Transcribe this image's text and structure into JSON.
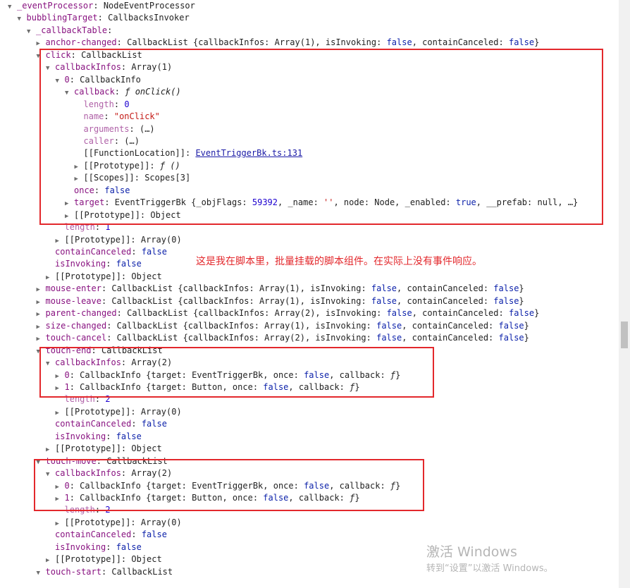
{
  "rows": [
    {
      "indent": 1,
      "arrow": "down",
      "parts": [
        [
          "key-own",
          "_eventProcessor"
        ],
        [
          "type",
          ": NodeEventProcessor"
        ]
      ]
    },
    {
      "indent": 2,
      "arrow": "down",
      "parts": [
        [
          "key-own",
          "bubblingTarget"
        ],
        [
          "type",
          ": CallbacksInvoker"
        ]
      ]
    },
    {
      "indent": 3,
      "arrow": "down",
      "parts": [
        [
          "key-own",
          "_callbackTable"
        ],
        [
          "type",
          ":"
        ]
      ]
    },
    {
      "indent": 4,
      "arrow": "right",
      "parts": [
        [
          "key-own",
          "anchor-changed"
        ],
        [
          "type",
          ": CallbackList {callbackInfos: Array(1), isInvoking: "
        ],
        [
          "bool",
          "false"
        ],
        [
          "type",
          ", containCanceled: "
        ],
        [
          "bool",
          "false"
        ],
        [
          "type",
          "}"
        ]
      ]
    },
    {
      "indent": 4,
      "arrow": "down",
      "parts": [
        [
          "key-own",
          "click"
        ],
        [
          "type",
          ": CallbackList"
        ]
      ]
    },
    {
      "indent": 5,
      "arrow": "down",
      "parts": [
        [
          "key-own",
          "callbackInfos"
        ],
        [
          "type",
          ": Array(1)"
        ]
      ]
    },
    {
      "indent": 6,
      "arrow": "down",
      "parts": [
        [
          "key-own",
          "0"
        ],
        [
          "type",
          ": CallbackInfo"
        ]
      ]
    },
    {
      "indent": 7,
      "arrow": "down",
      "parts": [
        [
          "key-own",
          "callback"
        ],
        [
          "type",
          ": "
        ],
        [
          "fn",
          "ƒ onClick()"
        ]
      ]
    },
    {
      "indent": 8,
      "arrow": "",
      "parts": [
        [
          "key-dim",
          "length"
        ],
        [
          "type",
          ": "
        ],
        [
          "num",
          "0"
        ]
      ]
    },
    {
      "indent": 8,
      "arrow": "",
      "parts": [
        [
          "key-dim",
          "name"
        ],
        [
          "type",
          ": "
        ],
        [
          "str",
          "\"onClick\""
        ]
      ]
    },
    {
      "indent": 8,
      "arrow": "",
      "parts": [
        [
          "key-dim",
          "arguments"
        ],
        [
          "type",
          ": (…)"
        ]
      ]
    },
    {
      "indent": 8,
      "arrow": "",
      "parts": [
        [
          "key-dim",
          "caller"
        ],
        [
          "type",
          ": (…)"
        ]
      ]
    },
    {
      "indent": 8,
      "arrow": "",
      "parts": [
        [
          "type",
          "[[FunctionLocation]]: "
        ],
        [
          "link",
          "EventTriggerBk.ts:131"
        ]
      ]
    },
    {
      "indent": 8,
      "arrow": "right",
      "parts": [
        [
          "type",
          "[[Prototype]]: "
        ],
        [
          "fn",
          "ƒ ()"
        ]
      ]
    },
    {
      "indent": 8,
      "arrow": "right",
      "parts": [
        [
          "type",
          "[[Scopes]]: Scopes[3]"
        ]
      ]
    },
    {
      "indent": 7,
      "arrow": "",
      "parts": [
        [
          "key-own",
          "once"
        ],
        [
          "type",
          ": "
        ],
        [
          "bool",
          "false"
        ]
      ]
    },
    {
      "indent": 7,
      "arrow": "right",
      "parts": [
        [
          "key-own",
          "target"
        ],
        [
          "type",
          ": EventTriggerBk {_objFlags: "
        ],
        [
          "num",
          "59392"
        ],
        [
          "type",
          ", _name: "
        ],
        [
          "str",
          "''"
        ],
        [
          "type",
          ", node: Node, _enabled: "
        ],
        [
          "bool",
          "true"
        ],
        [
          "type",
          ", __prefab: null, …}"
        ]
      ]
    },
    {
      "indent": 7,
      "arrow": "right",
      "parts": [
        [
          "type",
          "[[Prototype]]: Object"
        ]
      ]
    },
    {
      "indent": 6,
      "arrow": "",
      "parts": [
        [
          "key-dim",
          "length"
        ],
        [
          "type",
          ": "
        ],
        [
          "num",
          "1"
        ]
      ]
    },
    {
      "indent": 6,
      "arrow": "right",
      "parts": [
        [
          "type",
          "[[Prototype]]: Array(0)"
        ]
      ]
    },
    {
      "indent": 5,
      "arrow": "",
      "parts": [
        [
          "key-own",
          "containCanceled"
        ],
        [
          "type",
          ": "
        ],
        [
          "bool",
          "false"
        ]
      ]
    },
    {
      "indent": 5,
      "arrow": "",
      "parts": [
        [
          "key-own",
          "isInvoking"
        ],
        [
          "type",
          ": "
        ],
        [
          "bool",
          "false"
        ]
      ]
    },
    {
      "indent": 5,
      "arrow": "right",
      "parts": [
        [
          "type",
          "[[Prototype]]: Object"
        ]
      ]
    },
    {
      "indent": 4,
      "arrow": "right",
      "parts": [
        [
          "key-own",
          "mouse-enter"
        ],
        [
          "type",
          ": CallbackList {callbackInfos: Array(1), isInvoking: "
        ],
        [
          "bool",
          "false"
        ],
        [
          "type",
          ", containCanceled: "
        ],
        [
          "bool",
          "false"
        ],
        [
          "type",
          "}"
        ]
      ]
    },
    {
      "indent": 4,
      "arrow": "right",
      "parts": [
        [
          "key-own",
          "mouse-leave"
        ],
        [
          "type",
          ": CallbackList {callbackInfos: Array(1), isInvoking: "
        ],
        [
          "bool",
          "false"
        ],
        [
          "type",
          ", containCanceled: "
        ],
        [
          "bool",
          "false"
        ],
        [
          "type",
          "}"
        ]
      ]
    },
    {
      "indent": 4,
      "arrow": "right",
      "parts": [
        [
          "key-own",
          "parent-changed"
        ],
        [
          "type",
          ": CallbackList {callbackInfos: Array(2), isInvoking: "
        ],
        [
          "bool",
          "false"
        ],
        [
          "type",
          ", containCanceled: "
        ],
        [
          "bool",
          "false"
        ],
        [
          "type",
          "}"
        ]
      ]
    },
    {
      "indent": 4,
      "arrow": "right",
      "parts": [
        [
          "key-own",
          "size-changed"
        ],
        [
          "type",
          ": CallbackList {callbackInfos: Array(1), isInvoking: "
        ],
        [
          "bool",
          "false"
        ],
        [
          "type",
          ", containCanceled: "
        ],
        [
          "bool",
          "false"
        ],
        [
          "type",
          "}"
        ]
      ]
    },
    {
      "indent": 4,
      "arrow": "right",
      "parts": [
        [
          "key-own",
          "touch-cancel"
        ],
        [
          "type",
          ": CallbackList {callbackInfos: Array(2), isInvoking: "
        ],
        [
          "bool",
          "false"
        ],
        [
          "type",
          ", containCanceled: "
        ],
        [
          "bool",
          "false"
        ],
        [
          "type",
          "}"
        ]
      ]
    },
    {
      "indent": 4,
      "arrow": "down",
      "parts": [
        [
          "key-own",
          "touch-end"
        ],
        [
          "type",
          ": CallbackList"
        ]
      ]
    },
    {
      "indent": 5,
      "arrow": "down",
      "parts": [
        [
          "key-own",
          "callbackInfos"
        ],
        [
          "type",
          ": Array(2)"
        ]
      ]
    },
    {
      "indent": 6,
      "arrow": "right",
      "parts": [
        [
          "key-own",
          "0"
        ],
        [
          "type",
          ": CallbackInfo {target: EventTriggerBk, once: "
        ],
        [
          "bool",
          "false"
        ],
        [
          "type",
          ", callback: "
        ],
        [
          "fn",
          "ƒ"
        ],
        [
          "type",
          "}"
        ]
      ]
    },
    {
      "indent": 6,
      "arrow": "right",
      "parts": [
        [
          "key-own",
          "1"
        ],
        [
          "type",
          ": CallbackInfo {target: Button, once: "
        ],
        [
          "bool",
          "false"
        ],
        [
          "type",
          ", callback: "
        ],
        [
          "fn",
          "ƒ"
        ],
        [
          "type",
          "}"
        ]
      ]
    },
    {
      "indent": 6,
      "arrow": "",
      "parts": [
        [
          "key-dim",
          "length"
        ],
        [
          "type",
          ": "
        ],
        [
          "num",
          "2"
        ]
      ]
    },
    {
      "indent": 6,
      "arrow": "right",
      "parts": [
        [
          "type",
          "[[Prototype]]: Array(0)"
        ]
      ]
    },
    {
      "indent": 5,
      "arrow": "",
      "parts": [
        [
          "key-own",
          "containCanceled"
        ],
        [
          "type",
          ": "
        ],
        [
          "bool",
          "false"
        ]
      ]
    },
    {
      "indent": 5,
      "arrow": "",
      "parts": [
        [
          "key-own",
          "isInvoking"
        ],
        [
          "type",
          ": "
        ],
        [
          "bool",
          "false"
        ]
      ]
    },
    {
      "indent": 5,
      "arrow": "right",
      "parts": [
        [
          "type",
          "[[Prototype]]: Object"
        ]
      ]
    },
    {
      "indent": 4,
      "arrow": "down",
      "parts": [
        [
          "key-own",
          "touch-move"
        ],
        [
          "type",
          ": CallbackList"
        ]
      ]
    },
    {
      "indent": 5,
      "arrow": "down",
      "parts": [
        [
          "key-own",
          "callbackInfos"
        ],
        [
          "type",
          ": Array(2)"
        ]
      ]
    },
    {
      "indent": 6,
      "arrow": "right",
      "parts": [
        [
          "key-own",
          "0"
        ],
        [
          "type",
          ": CallbackInfo {target: EventTriggerBk, once: "
        ],
        [
          "bool",
          "false"
        ],
        [
          "type",
          ", callback: "
        ],
        [
          "fn",
          "ƒ"
        ],
        [
          "type",
          "}"
        ]
      ]
    },
    {
      "indent": 6,
      "arrow": "right",
      "parts": [
        [
          "key-own",
          "1"
        ],
        [
          "type",
          ": CallbackInfo {target: Button, once: "
        ],
        [
          "bool",
          "false"
        ],
        [
          "type",
          ", callback: "
        ],
        [
          "fn",
          "ƒ"
        ],
        [
          "type",
          "}"
        ]
      ]
    },
    {
      "indent": 6,
      "arrow": "",
      "parts": [
        [
          "key-dim",
          "length"
        ],
        [
          "type",
          ": "
        ],
        [
          "num",
          "2"
        ]
      ]
    },
    {
      "indent": 6,
      "arrow": "right",
      "parts": [
        [
          "type",
          "[[Prototype]]: Array(0)"
        ]
      ]
    },
    {
      "indent": 5,
      "arrow": "",
      "parts": [
        [
          "key-own",
          "containCanceled"
        ],
        [
          "type",
          ": "
        ],
        [
          "bool",
          "false"
        ]
      ]
    },
    {
      "indent": 5,
      "arrow": "",
      "parts": [
        [
          "key-own",
          "isInvoking"
        ],
        [
          "type",
          ": "
        ],
        [
          "bool",
          "false"
        ]
      ]
    },
    {
      "indent": 5,
      "arrow": "right",
      "parts": [
        [
          "type",
          "[[Prototype]]: Object"
        ]
      ]
    },
    {
      "indent": 4,
      "arrow": "down",
      "parts": [
        [
          "key-own",
          "touch-start"
        ],
        [
          "type",
          ": CallbackList"
        ]
      ]
    }
  ],
  "note": "这是我在脚本里，批量挂载的脚本组件。在实际上没有事件响应。",
  "watermark": {
    "title": "激活 Windows",
    "subtitle": "转到“设置”以激活 Windows。"
  },
  "colors": {
    "highlight": "#e3282c",
    "property": "#881280",
    "string": "#c41a16",
    "number": "#1c00cf",
    "boolean": "#0d22aa"
  }
}
